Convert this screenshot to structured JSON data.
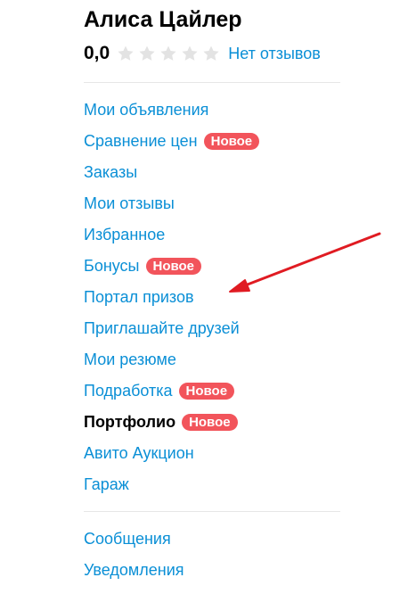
{
  "profile": {
    "name": "Алиса Цайлер",
    "rating": "0,0",
    "stars_filled": 0,
    "stars_total": 5,
    "reviews_link": "Нет отзывов"
  },
  "menu": {
    "items": [
      {
        "label": "Мои объявления"
      },
      {
        "label": "Сравнение цен",
        "badge": "Новое"
      },
      {
        "label": "Заказы"
      },
      {
        "label": "Мои отзывы"
      },
      {
        "label": "Избранное"
      },
      {
        "label": "Бонусы",
        "badge": "Новое"
      },
      {
        "label": "Портал призов"
      },
      {
        "label": "Приглашайте друзей"
      },
      {
        "label": "Мои резюме"
      },
      {
        "label": "Подработка",
        "badge": "Новое"
      },
      {
        "label": "Портфолио",
        "badge": "Новое",
        "active": true
      },
      {
        "label": "Авито Аукцион"
      },
      {
        "label": "Гараж"
      }
    ],
    "secondary": [
      {
        "label": "Сообщения"
      },
      {
        "label": "Уведомления"
      }
    ]
  },
  "colors": {
    "link": "#0a8fd6",
    "badge_bg": "#f2545b",
    "star_empty": "#e3e3e3",
    "arrow": "#e01b22"
  },
  "icons": {
    "star": "star-icon",
    "annotation": "red-arrow-annotation"
  }
}
